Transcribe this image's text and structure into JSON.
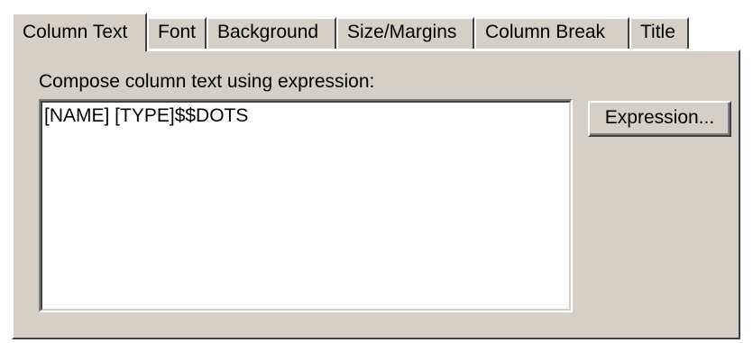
{
  "tabs": [
    {
      "label": "Column Text",
      "active": true
    },
    {
      "label": "Font",
      "active": false
    },
    {
      "label": "Background",
      "active": false
    },
    {
      "label": "Size/Margins",
      "active": false
    },
    {
      "label": "Column Break",
      "active": false
    },
    {
      "label": "Title",
      "active": false
    }
  ],
  "column_text": {
    "label": "Compose column text using expression:",
    "expression_value": "[NAME] [TYPE]$$DOTS",
    "expression_button_label": "Expression..."
  },
  "colors": {
    "dialog_face": "#d4d0c8",
    "field_background": "#ffffff",
    "text": "#000000"
  }
}
